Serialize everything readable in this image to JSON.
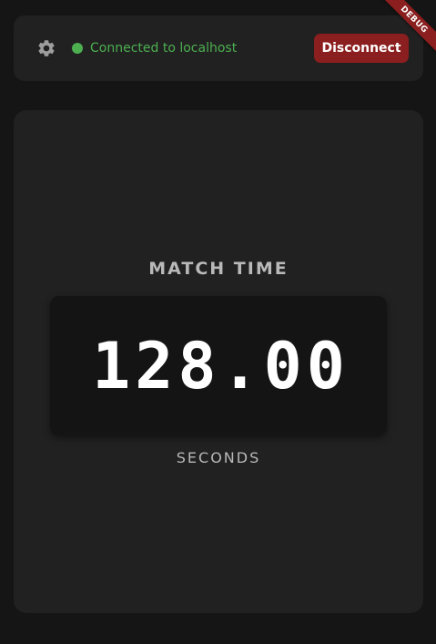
{
  "connection": {
    "status_text": "Connected to localhost",
    "status_color": "#4caf50",
    "disconnect_label": "Disconnect",
    "disconnect_color": "#8b1e1e",
    "settings_icon": "gear-icon"
  },
  "timer": {
    "title": "MATCH TIME",
    "value": "128.00",
    "units": "SECONDS"
  },
  "debug_banner": {
    "label": "DEBUG",
    "color": "#8b1e1e"
  }
}
